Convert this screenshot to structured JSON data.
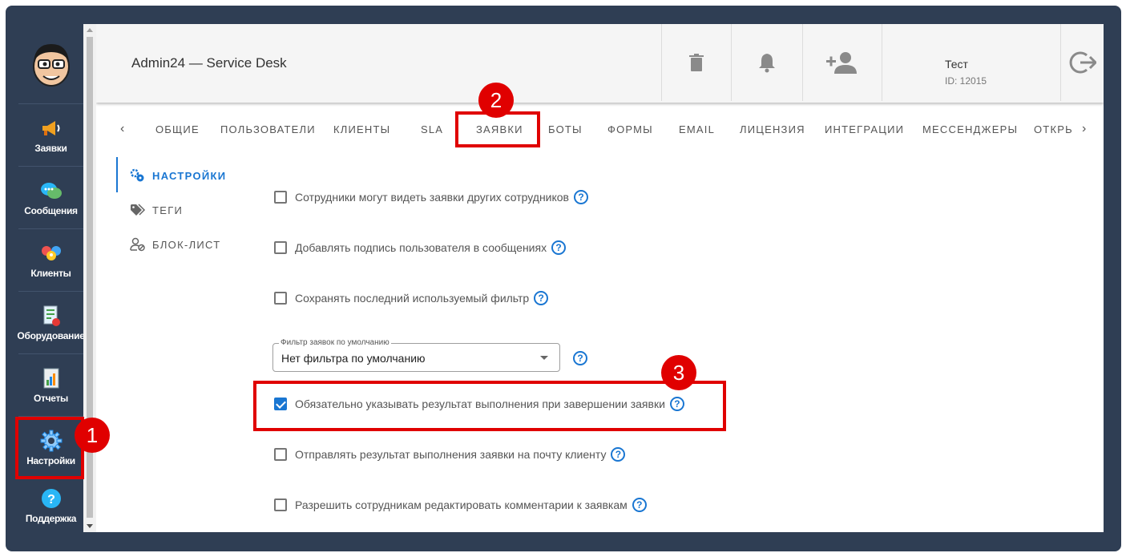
{
  "app": {
    "title": "Admin24 — Service Desk"
  },
  "sidebar": {
    "items": [
      {
        "label": "Заявки",
        "icon": "megaphone-icon"
      },
      {
        "label": "Сообщения",
        "icon": "chat-bubbles-icon"
      },
      {
        "label": "Клиенты",
        "icon": "clients-icon"
      },
      {
        "label": "Оборудование",
        "icon": "equipment-icon"
      },
      {
        "label": "Отчеты",
        "icon": "report-icon"
      },
      {
        "label": "Настройки",
        "icon": "gear-icon"
      },
      {
        "label": "Поддержка",
        "icon": "help-icon"
      }
    ]
  },
  "topbar": {
    "user_name": "Тест",
    "user_id": "ID: 12015",
    "icons": [
      "trash-icon",
      "bell-icon",
      "add-user-icon",
      "logout-icon"
    ]
  },
  "tabs": {
    "items": [
      "Общие",
      "Пользователи",
      "Клиенты",
      "SLA",
      "Заявки",
      "Боты",
      "Формы",
      "Email",
      "Лицензия",
      "Интеграции",
      "Мессенджеры",
      "Откры"
    ],
    "active": "Заявки"
  },
  "subnav": {
    "items": [
      "Настройки",
      "Теги",
      "Блок-лист"
    ],
    "active": "Настройки"
  },
  "settings": {
    "options": [
      {
        "label": "Сотрудники могут видеть заявки других сотрудников",
        "checked": false
      },
      {
        "label": "Добавлять подпись пользователя в сообщениях",
        "checked": false
      },
      {
        "label": "Сохранять последний используемый фильтр",
        "checked": false
      },
      {
        "label": "Обязательно указывать результат выполнения при завершении заявки",
        "checked": true
      },
      {
        "label": "Отправлять результат выполнения заявки на почту клиенту",
        "checked": false
      },
      {
        "label": "Разрешить сотрудникам редактировать комментарии к заявкам",
        "checked": false
      }
    ],
    "filter_select": {
      "label": "Фильтр заявок по умолчанию",
      "value": "Нет фильтра по умолчанию"
    },
    "help_glyph": "?"
  },
  "annotations": {
    "markers": [
      "1",
      "2",
      "3"
    ],
    "color": "#e00000"
  }
}
